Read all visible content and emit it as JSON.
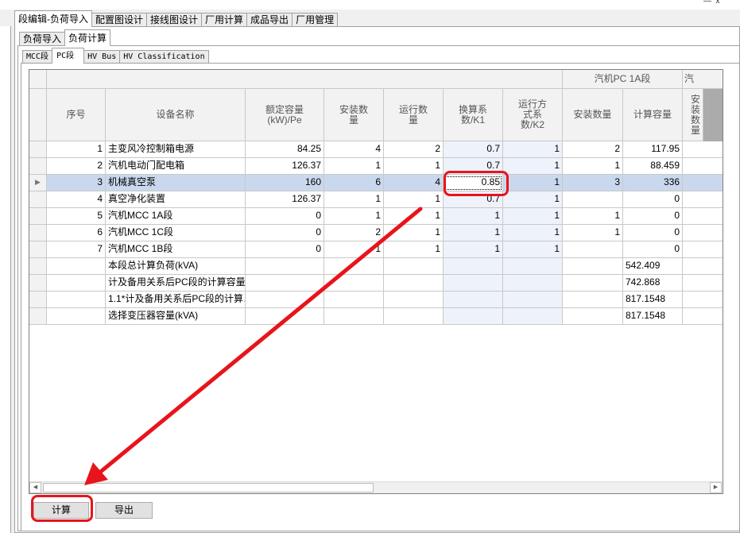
{
  "main_tabs": [
    "段编辑-负荷导入",
    "配置图设计",
    "接线图设计",
    "厂用计算",
    "成品导出",
    "厂用管理"
  ],
  "sub_tabs": [
    "负荷导入",
    "负荷计算"
  ],
  "section_tabs": [
    "MCC段",
    "PC段",
    "HV Bus",
    "HV Classification"
  ],
  "header": {
    "group_pc": "汽机PC 1A段",
    "group_next": "汽",
    "columns": [
      "序号",
      "设备名称",
      "额定容量(kW)/Pe",
      "安装数量",
      "运行数量",
      "换算系数/K1",
      "运行方式系数/K2",
      "安装数量",
      "计算容量",
      "安装数量"
    ]
  },
  "rows": [
    {
      "no": "1",
      "name": "主变风冷控制箱电源",
      "pe": "84.25",
      "install": "4",
      "run": "2",
      "k1": "0.7",
      "k2": "1",
      "pc_install": "2",
      "pc_calc": "117.95"
    },
    {
      "no": "2",
      "name": "汽机电动门配电箱",
      "pe": "126.37",
      "install": "1",
      "run": "1",
      "k1": "0.7",
      "k2": "1",
      "pc_install": "1",
      "pc_calc": "88.459"
    },
    {
      "no": "3",
      "name": "机械真空泵",
      "pe": "160",
      "install": "6",
      "run": "4",
      "k1": "0.85",
      "k2": "1",
      "pc_install": "3",
      "pc_calc": "336"
    },
    {
      "no": "4",
      "name": "真空净化装置",
      "pe": "126.37",
      "install": "1",
      "run": "1",
      "k1": "0.7",
      "k2": "1",
      "pc_install": "",
      "pc_calc": "0"
    },
    {
      "no": "5",
      "name": "汽机MCC 1A段",
      "pe": "0",
      "install": "1",
      "run": "1",
      "k1": "1",
      "k2": "1",
      "pc_install": "1",
      "pc_calc": "0"
    },
    {
      "no": "6",
      "name": "汽机MCC 1C段",
      "pe": "0",
      "install": "2",
      "run": "1",
      "k1": "1",
      "k2": "1",
      "pc_install": "1",
      "pc_calc": "0"
    },
    {
      "no": "7",
      "name": "汽机MCC 1B段",
      "pe": "0",
      "install": "1",
      "run": "1",
      "k1": "1",
      "k2": "1",
      "pc_install": "",
      "pc_calc": "0"
    }
  ],
  "summary": [
    {
      "label": "本段总计算负荷(kVA)",
      "value": "542.409"
    },
    {
      "label": "计及备用关系后PC段的计算容量(…",
      "value": "742.868"
    },
    {
      "label": "1.1*计及备用关系后PC段的计算…",
      "value": "817.1548"
    },
    {
      "label": "选择变压器容量(kVA)",
      "value": "817.1548"
    }
  ],
  "buttons": {
    "calc": "计算",
    "export": "导出"
  },
  "colors": {
    "highlight": "#e8141c",
    "selected_row": "#cad8ee"
  }
}
